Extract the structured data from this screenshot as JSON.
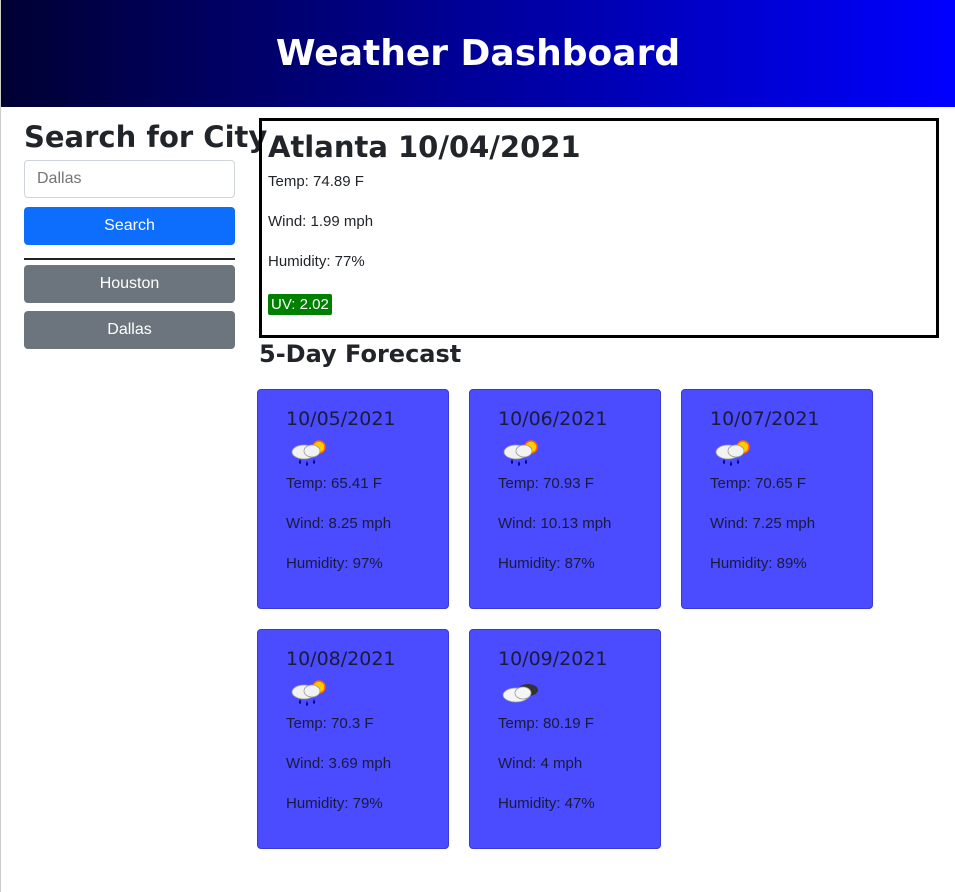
{
  "header": {
    "title": "Weather Dashboard"
  },
  "sidebar": {
    "heading": "Search for City",
    "search_placeholder": "Dallas",
    "search_button": "Search",
    "history": [
      {
        "label": "Houston"
      },
      {
        "label": "Dallas"
      }
    ]
  },
  "current": {
    "title": "Atlanta 10/04/2021",
    "temp": "Temp: 74.89 F",
    "wind": "Wind: 1.99 mph",
    "humidity": "Humidity: 77%",
    "uv": "UV: 2.02",
    "uv_color": "#008000"
  },
  "forecast": {
    "title": "5-Day Forecast",
    "card_color": "#4b4bff",
    "days": [
      {
        "date": "10/05/2021",
        "icon": "rain-sun-icon",
        "temp": "Temp: 65.41 F",
        "wind": "Wind: 8.25 mph",
        "humidity": "Humidity: 97%"
      },
      {
        "date": "10/06/2021",
        "icon": "rain-sun-icon",
        "temp": "Temp: 70.93 F",
        "wind": "Wind: 10.13 mph",
        "humidity": "Humidity: 87%"
      },
      {
        "date": "10/07/2021",
        "icon": "rain-sun-icon",
        "temp": "Temp: 70.65 F",
        "wind": "Wind: 7.25 mph",
        "humidity": "Humidity: 89%"
      },
      {
        "date": "10/08/2021",
        "icon": "rain-sun-icon",
        "temp": "Temp: 70.3 F",
        "wind": "Wind: 3.69 mph",
        "humidity": "Humidity: 79%"
      },
      {
        "date": "10/09/2021",
        "icon": "cloud-icon",
        "temp": "Temp: 80.19 F",
        "wind": "Wind: 4 mph",
        "humidity": "Humidity: 47%"
      }
    ]
  }
}
